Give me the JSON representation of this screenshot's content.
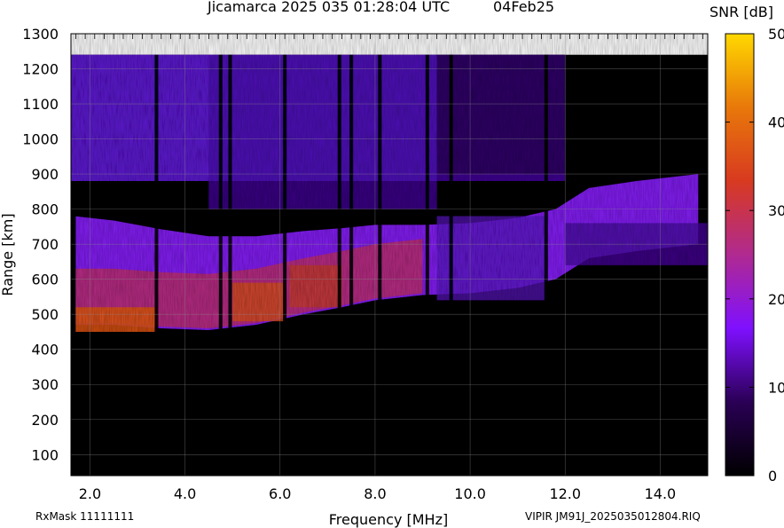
{
  "header": {
    "title": "Jicamarca 2025 035 01:28:04 UTC",
    "date": "04Feb25"
  },
  "footer": {
    "rxmask": "RxMask 11111111",
    "file": "VIPIR  JM91J_2025035012804.RIQ"
  },
  "colorbar": {
    "title": "SNR [dB]",
    "ticks": [
      0,
      10,
      20,
      30,
      40,
      50
    ],
    "range": [
      0,
      50
    ],
    "colors": [
      "#000000",
      "#2a0055",
      "#7f10ff",
      "#b02a90",
      "#d83a20",
      "#e8780a",
      "#ffd800"
    ]
  },
  "chart_data": {
    "type": "heatmap",
    "title": "Jicamarca 2025 035 01:28:04 UTC",
    "xlabel": "Frequency [MHz]",
    "ylabel": "Range [km]",
    "xlim": [
      1.6,
      15.0
    ],
    "ylim": [
      40,
      1300
    ],
    "xticks": [
      "2.0",
      "4.0",
      "6.0",
      "8.0",
      "10.0",
      "12.0",
      "14.0"
    ],
    "yticks": [
      "100",
      "200",
      "300",
      "400",
      "500",
      "600",
      "700",
      "800",
      "900",
      "1000",
      "1100",
      "1200",
      "1300"
    ],
    "grid": true,
    "zlabel": "SNR [dB]",
    "zlim": [
      0,
      50
    ],
    "ionogram_traces": [
      {
        "name": "",
        "points": [
          [
            1.7,
            470
          ],
          [
            2.5,
            470
          ],
          [
            3.5,
            460
          ],
          [
            4.5,
            455
          ],
          [
            5.5,
            470
          ],
          [
            6.5,
            500
          ],
          [
            7.3,
            520
          ],
          [
            8.0,
            540
          ],
          [
            9.0,
            555
          ],
          [
            10.0,
            560
          ],
          [
            11.0,
            575
          ],
          [
            11.8,
            600
          ],
          [
            12.5,
            660
          ],
          [
            13.5,
            680
          ],
          [
            14.8,
            700
          ]
        ]
      }
    ],
    "vertical_gaps_mhz": [
      3.4,
      4.75,
      4.95,
      6.1,
      7.25,
      7.5,
      8.1,
      9.1,
      9.6,
      11.6
    ]
  }
}
